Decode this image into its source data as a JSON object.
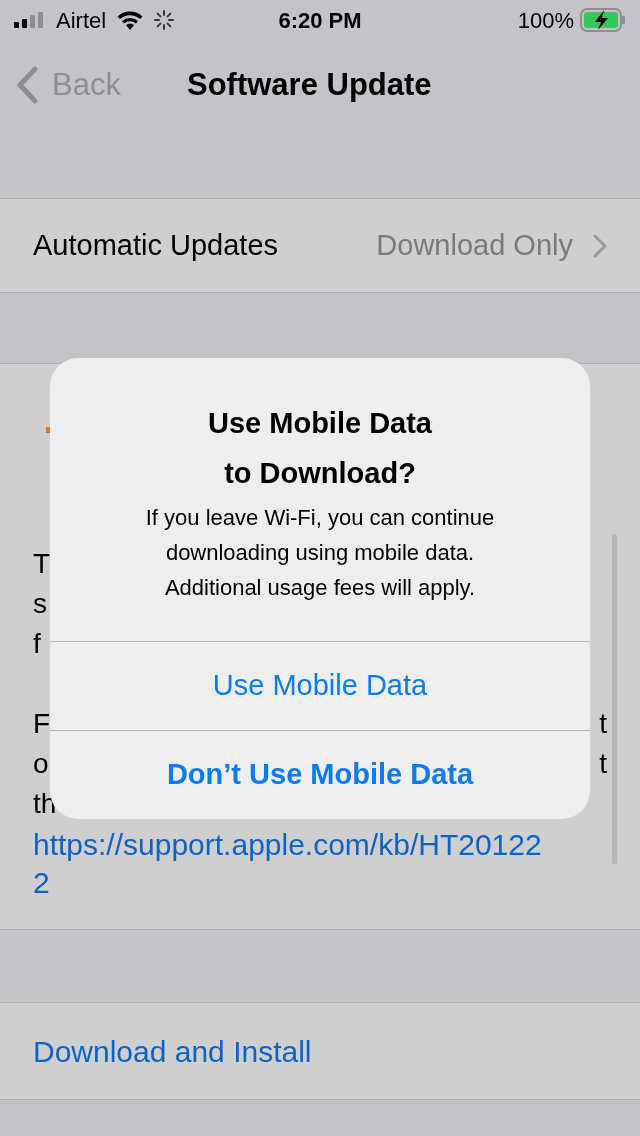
{
  "status_bar": {
    "carrier": "Airtel",
    "time": "6:20 PM",
    "battery": "100%"
  },
  "nav": {
    "back": "Back",
    "title": "Software Update"
  },
  "automatic_updates": {
    "label": "Automatic Updates",
    "value": "Download Only"
  },
  "partial_paragraphs": [
    [
      {
        "left": "T"
      },
      {
        "left": "s"
      },
      {
        "left": "f"
      }
    ],
    [
      {
        "left": "F",
        "right": "t"
      },
      {
        "left": "o",
        "right": "t"
      },
      {
        "left": "th"
      }
    ]
  ],
  "link": "https://support.apple.com/kb/HT201222",
  "action": "Download and Install",
  "alert": {
    "title": "Use Mobile Data to Download?",
    "message": "If you leave Wi-Fi, you can continue downloading using mobile data. Additional usage fees will apply.",
    "buttons": [
      {
        "label": "Use Mobile Data",
        "bold": false
      },
      {
        "label": "Don’t Use Mobile Data",
        "bold": true
      }
    ]
  }
}
